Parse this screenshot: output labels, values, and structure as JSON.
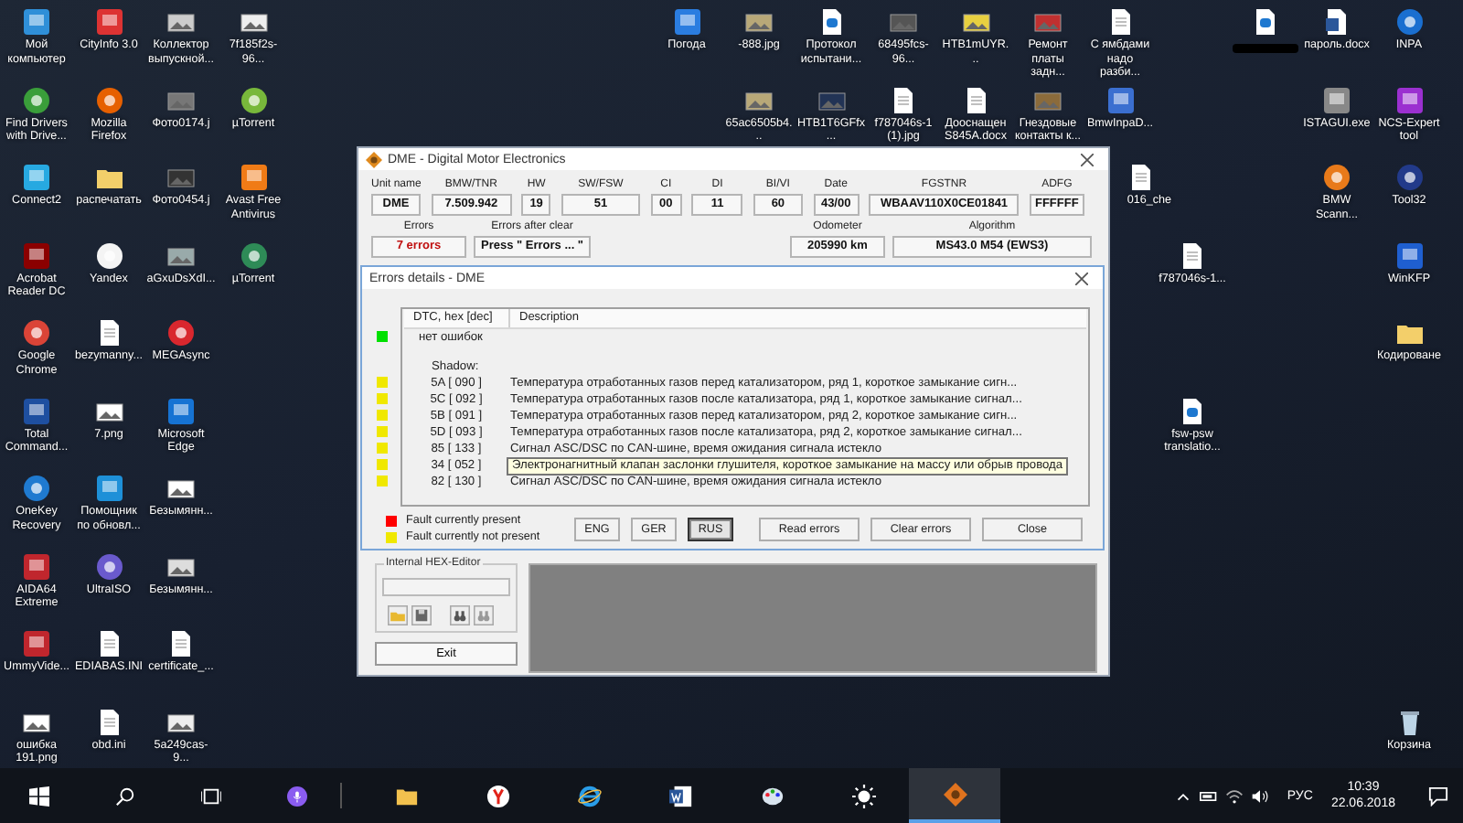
{
  "desktop_icons": [
    {
      "label": "Мой компьютер"
    },
    {
      "label": "Find Drivers with Drive..."
    },
    {
      "label": "Connect2"
    },
    {
      "label": "Acrobat Reader DC"
    },
    {
      "label": "Google Chrome"
    },
    {
      "label": "Total Command..."
    },
    {
      "label": "OneKey Recovery"
    },
    {
      "label": "AIDA64 Extreme"
    },
    {
      "label": "UmmyVide..."
    },
    {
      "label": "ошибка 191.png"
    },
    {
      "label": "CityInfo 3.0"
    },
    {
      "label": "Mozilla Firefox"
    },
    {
      "label": "распечатать"
    },
    {
      "label": "Yandex"
    },
    {
      "label": "bezymanny..."
    },
    {
      "label": "7.png"
    },
    {
      "label": "Помощник по обновл..."
    },
    {
      "label": "UltraISO"
    },
    {
      "label": "EDIABAS.INI"
    },
    {
      "label": "obd.ini"
    },
    {
      "label": "Коллектор выпускной..."
    },
    {
      "label": "Фото0174.j"
    },
    {
      "label": "Фото0454.j"
    },
    {
      "label": "aGxuDsXdI..."
    },
    {
      "label": "MEGAsync"
    },
    {
      "label": "Microsoft Edge"
    },
    {
      "label": "Безымянн..."
    },
    {
      "label": "Безымянн..."
    },
    {
      "label": "certificate_..."
    },
    {
      "label": "5a249cas-9..."
    },
    {
      "label": "7f185f2s-96..."
    },
    {
      "label": "µTorrent"
    },
    {
      "label": "Avast Free Antivirus"
    },
    {
      "label": "µTorrent"
    },
    {
      "label": "Погода"
    },
    {
      "label": "-888.jpg"
    },
    {
      "label": "Протокол испытани..."
    },
    {
      "label": "68495fcs-96..."
    },
    {
      "label": "HTB1mUYR..."
    },
    {
      "label": "Ремонт платы задн..."
    },
    {
      "label": "С ямбдами надо разби..."
    },
    {
      "label": "65ac6505b4..."
    },
    {
      "label": "HTB1T6GFfx..."
    },
    {
      "label": "f787046s-1 (1).jpg"
    },
    {
      "label": "Дооснащен S845A.docx"
    },
    {
      "label": "Гнездовые контакты к..."
    },
    {
      "label": "BmwInpaD..."
    },
    {
      "label": "016_che"
    },
    {
      "label": "f787046s-1..."
    },
    {
      "label": "fsw-psw translatio..."
    },
    {
      "redacted": true
    },
    {
      "label": "пароль.docx"
    },
    {
      "label": "ISTAGUI.exe"
    },
    {
      "label": "BMW Scann..."
    },
    {
      "label": "INPA"
    },
    {
      "label": "NCS-Expert tool"
    },
    {
      "label": "Tool32"
    },
    {
      "label": "WinKFP"
    },
    {
      "label": "Кодироване"
    },
    {
      "label": "Корзина"
    }
  ],
  "dme_window": {
    "title": "DME - Digital Motor Electronics",
    "fields": [
      {
        "label": "Unit name",
        "value": "DME"
      },
      {
        "label": "BMW/TNR",
        "value": "7.509.942"
      },
      {
        "label": "HW",
        "value": "19"
      },
      {
        "label": "SW/FSW",
        "value": "51"
      },
      {
        "label": "CI",
        "value": "00"
      },
      {
        "label": "DI",
        "value": "11"
      },
      {
        "label": "BI/VI",
        "value": "60"
      },
      {
        "label": "Date",
        "value": "43/00"
      },
      {
        "label": "FGSTNR",
        "value": "WBAAV110X0CE01841"
      },
      {
        "label": "ADFG",
        "value": "FFFFFF"
      }
    ],
    "status_fields": [
      {
        "label": "Errors",
        "value": "7 errors",
        "alert": true
      },
      {
        "label": "Errors after clear",
        "value": "Press \" Errors ... \"",
        "alert": false
      },
      {
        "label": "Odometer",
        "value": "205990 km",
        "alert": false
      },
      {
        "label": "Algorithm",
        "value": "MS43.0 M54 (EWS3)",
        "alert": false
      }
    ],
    "hex_editor": {
      "title": "Internal HEX-Editor"
    },
    "exit_button": "Exit"
  },
  "errors_dialog": {
    "title": "Errors details - DME",
    "columns": [
      "DTC, hex [dec]",
      "Description"
    ],
    "rows": [
      {
        "kind": "status",
        "color": "#00e000",
        "description": "нет ошибок"
      },
      {
        "kind": "heading",
        "description": "Shadow:"
      },
      {
        "kind": "fault",
        "color": "#f0e800",
        "code": "5A [ 090 ]",
        "description": "Температура отработанных газов перед катализатором, ряд 1, короткое замыкание сигн..."
      },
      {
        "kind": "fault",
        "color": "#f0e800",
        "code": "5C [ 092 ]",
        "description": "Температура отработанных газов после катализатора, ряд 1, короткое замыкание сигнал..."
      },
      {
        "kind": "fault",
        "color": "#f0e800",
        "code": "5B [ 091 ]",
        "description": "Температура отработанных газов перед катализатором, ряд 2, короткое замыкание сигн..."
      },
      {
        "kind": "fault",
        "color": "#f0e800",
        "code": "5D [ 093 ]",
        "description": "Температура отработанных газов после катализатора, ряд 2, короткое замыкание сигнал..."
      },
      {
        "kind": "fault",
        "color": "#f0e800",
        "code": "85 [ 133 ]",
        "description": "Сигнал ASC/DSC по CAN-шине, время ожидания сигнала истекло"
      },
      {
        "kind": "fault",
        "color": "#f0e800",
        "code": "34 [ 052 ]",
        "description": "Электронагнитный клапан заслонки глушителя, короткое замыкание на массу или обрыв провода",
        "tooltip": true
      },
      {
        "kind": "fault",
        "color": "#f0e800",
        "code": "82 [ 130 ]",
        "description": "Сигнал ASC/DSC по CAN-шине, время ожидания сигнала истекло"
      }
    ],
    "legend": [
      {
        "color": "#ff0000",
        "label": "Fault currently present"
      },
      {
        "color": "#f0e800",
        "label": "Fault currently not present"
      }
    ],
    "language_buttons": [
      {
        "label": "ENG",
        "selected": false
      },
      {
        "label": "GER",
        "selected": false
      },
      {
        "label": "RUS",
        "selected": true
      }
    ],
    "buttons": [
      "Read errors",
      "Clear errors",
      "Close"
    ]
  },
  "taskbar": {
    "apps": [
      {
        "selected": false
      },
      {
        "selected": false
      },
      {
        "selected": false
      },
      {
        "selected": false
      },
      {
        "selected": false
      },
      {
        "selected": false
      },
      {
        "selected": true
      }
    ],
    "language": "РУС",
    "time": "10:39",
    "date": "22.06.2018"
  }
}
